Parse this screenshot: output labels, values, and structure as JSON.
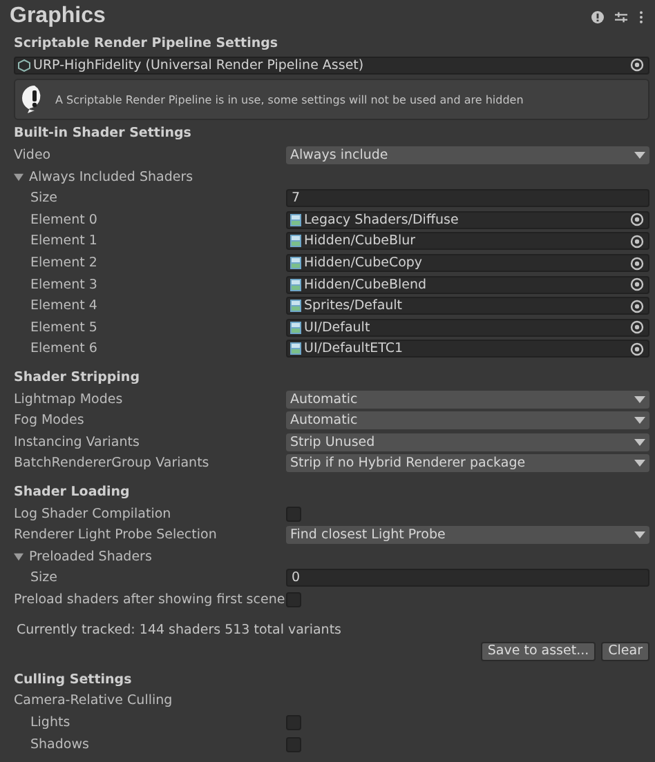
{
  "title": "Graphics",
  "sections": [
    {
      "title": "Scriptable Render Pipeline Settings",
      "items": [
        {
          "kind": "asset",
          "value": "URP-HighFidelity (Universal Render Pipeline Asset)"
        },
        {
          "kind": "helpbox",
          "text": "A Scriptable Render Pipeline is in use, some settings will not be used and are hidden"
        }
      ]
    },
    {
      "title": "Built-in Shader Settings",
      "items": [
        {
          "kind": "dropdown",
          "label": "Video",
          "value": "Always include"
        },
        {
          "kind": "foldout",
          "label": "Always Included Shaders",
          "expanded": true,
          "children": [
            {
              "kind": "number",
              "label": "Size",
              "value": "7"
            },
            {
              "kind": "object",
              "label": "Element 0",
              "value": "Legacy Shaders/Diffuse"
            },
            {
              "kind": "object",
              "label": "Element 1",
              "value": "Hidden/CubeBlur"
            },
            {
              "kind": "object",
              "label": "Element 2",
              "value": "Hidden/CubeCopy"
            },
            {
              "kind": "object",
              "label": "Element 3",
              "value": "Hidden/CubeBlend"
            },
            {
              "kind": "object",
              "label": "Element 4",
              "value": "Sprites/Default"
            },
            {
              "kind": "object",
              "label": "Element 5",
              "value": "UI/Default"
            },
            {
              "kind": "object",
              "label": "Element 6",
              "value": "UI/DefaultETC1"
            }
          ]
        }
      ]
    },
    {
      "title": "Shader Stripping",
      "items": [
        {
          "kind": "dropdown",
          "label": "Lightmap Modes",
          "value": "Automatic"
        },
        {
          "kind": "dropdown",
          "label": "Fog Modes",
          "value": "Automatic"
        },
        {
          "kind": "dropdown",
          "label": "Instancing Variants",
          "value": "Strip Unused"
        },
        {
          "kind": "dropdown",
          "label": "BatchRendererGroup Variants",
          "value": "Strip if no Hybrid Renderer package"
        }
      ]
    },
    {
      "title": "Shader Loading",
      "items": [
        {
          "kind": "checkbox",
          "label": "Log Shader Compilation",
          "checked": false
        },
        {
          "kind": "dropdown",
          "label": "Renderer Light Probe Selection",
          "value": "Find closest Light Probe"
        },
        {
          "kind": "foldout",
          "label": "Preloaded Shaders",
          "expanded": true,
          "children": [
            {
              "kind": "number",
              "label": "Size",
              "value": "0"
            }
          ]
        },
        {
          "kind": "checkbox",
          "label": "Preload shaders after showing first scene",
          "checked": false
        },
        {
          "kind": "note",
          "text": "Currently tracked: 144 shaders 513 total variants"
        },
        {
          "kind": "buttons",
          "buttons": [
            "Save to asset...",
            "Clear"
          ]
        }
      ]
    },
    {
      "title": "Culling Settings",
      "items": [
        {
          "kind": "group",
          "label": "Camera-Relative Culling",
          "children": [
            {
              "kind": "checkbox",
              "label": "Lights",
              "checked": false
            },
            {
              "kind": "checkbox",
              "label": "Shadows",
              "checked": false
            }
          ]
        }
      ]
    }
  ]
}
